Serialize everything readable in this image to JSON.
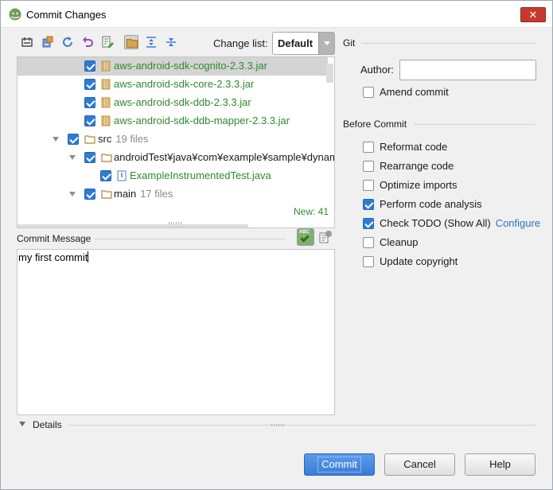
{
  "window": {
    "title": "Commit Changes",
    "close_label": "✕"
  },
  "toolbar": {
    "icons": [
      "diff-icon",
      "move-to-changelist-icon",
      "refresh-icon",
      "rollback-icon",
      "edit-source-icon",
      "group-by-directory-icon",
      "expand-all-icon",
      "collapse-all-icon"
    ],
    "changelist_label": "Change list:",
    "changelist_value": "Default"
  },
  "tree": {
    "rows": [
      {
        "name": "aws-android-sdk-cognito-2.3.3.jar",
        "type": "jar",
        "status": "new",
        "selected": true
      },
      {
        "name": "aws-android-sdk-core-2.3.3.jar",
        "type": "jar",
        "status": "new"
      },
      {
        "name": "aws-android-sdk-ddb-2.3.3.jar",
        "type": "jar",
        "status": "new"
      },
      {
        "name": "aws-android-sdk-ddb-mapper-2.3.3.jar",
        "type": "jar",
        "status": "new"
      },
      {
        "name": "src",
        "count": "19 files",
        "type": "folder"
      },
      {
        "name": "androidTest¥java¥com¥example¥sample¥dynamodb",
        "type": "folder"
      },
      {
        "name": "ExampleInstrumentedTest.java",
        "type": "java",
        "status": "new"
      },
      {
        "name": "main",
        "count": "17 files",
        "type": "folder"
      }
    ],
    "new_count": "New: 41"
  },
  "commit_message": {
    "label": "Commit Message",
    "value": "my first commit"
  },
  "git": {
    "title": "Git",
    "author_label": "Author:",
    "author_value": "",
    "amend_label": "Amend commit",
    "amend_checked": false
  },
  "before_commit": {
    "title": "Before Commit",
    "options": [
      {
        "label": "Reformat code",
        "checked": false
      },
      {
        "label": "Rearrange code",
        "checked": false
      },
      {
        "label": "Optimize imports",
        "checked": false
      },
      {
        "label": "Perform code analysis",
        "checked": true
      },
      {
        "label": "Check TODO (Show All)",
        "checked": true,
        "link": "Configure"
      },
      {
        "label": "Cleanup",
        "checked": false
      },
      {
        "label": "Update copyright",
        "checked": false
      }
    ]
  },
  "details": {
    "label": "Details"
  },
  "buttons": {
    "commit": "Commit",
    "cancel": "Cancel",
    "help": "Help"
  },
  "colors": {
    "accent": "#2e7bd2",
    "new_file": "#2e8a2e",
    "link": "#2c73c6",
    "close": "#c7392c"
  }
}
